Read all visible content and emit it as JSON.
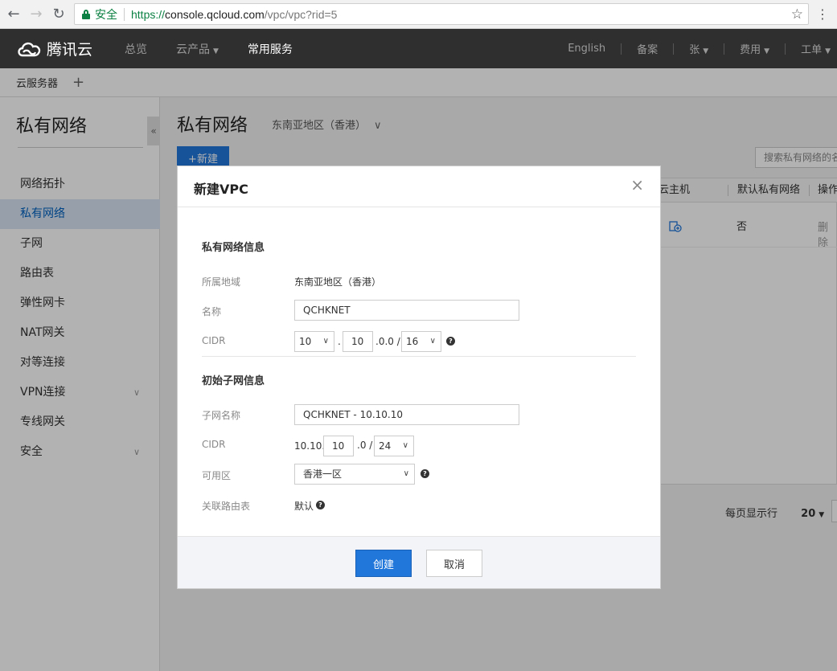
{
  "browser": {
    "secure_label": "安全",
    "url_scheme": "https://",
    "url_host": "console.qcloud.com",
    "url_path": "/vpc/vpc?rid=5"
  },
  "topnav": {
    "brand": "腾讯云",
    "items": [
      "总览",
      "云产品",
      "常用服务"
    ],
    "right": [
      "English",
      "备案",
      "张",
      "费用",
      "工单"
    ]
  },
  "subnav": {
    "tab": "云服务器",
    "add": "+"
  },
  "sidebar": {
    "title": "私有网络",
    "collapse": "«",
    "items": [
      "网络拓扑",
      "私有网络",
      "子网",
      "路由表",
      "弹性网卡",
      "NAT网关",
      "对等连接",
      "VPN连接",
      "专线网关",
      "安全"
    ]
  },
  "main": {
    "title": "私有网络",
    "region": "东南亚地区（香港）",
    "new_button": "+新建",
    "search_placeholder": "搜索私有网络的名",
    "columns": [
      "云主机",
      "默认私有网络",
      "操作"
    ],
    "row": {
      "default_vpc": "否",
      "action": "删除"
    },
    "pager_label": "每页显示行",
    "pager_size": "20"
  },
  "dialog": {
    "title": "新建VPC",
    "close": "×",
    "vpc_section": "私有网络信息",
    "region_label": "所属地域",
    "region_value": "东南亚地区（香港）",
    "name_label": "名称",
    "name_value": "QCHKNET",
    "cidr_label": "CIDR",
    "cidr_first": "10",
    "cidr_dot": ".",
    "cidr_second": "10",
    "cidr_suffix": ".0.0 /",
    "cidr_mask": "16",
    "subnet_section": "初始子网信息",
    "subnet_name_label": "子网名称",
    "subnet_name_value": "QCHKNET - 10.10.10",
    "subnet_cidr_label": "CIDR",
    "subnet_cidr_prefix": "10.10.",
    "subnet_cidr_third": "10",
    "subnet_cidr_suffix": ".0 /",
    "subnet_cidr_mask": "24",
    "zone_label": "可用区",
    "zone_value": "香港一区",
    "route_label": "关联路由表",
    "route_value": "默认",
    "help": "?",
    "create_button": "创建",
    "cancel_button": "取消"
  }
}
